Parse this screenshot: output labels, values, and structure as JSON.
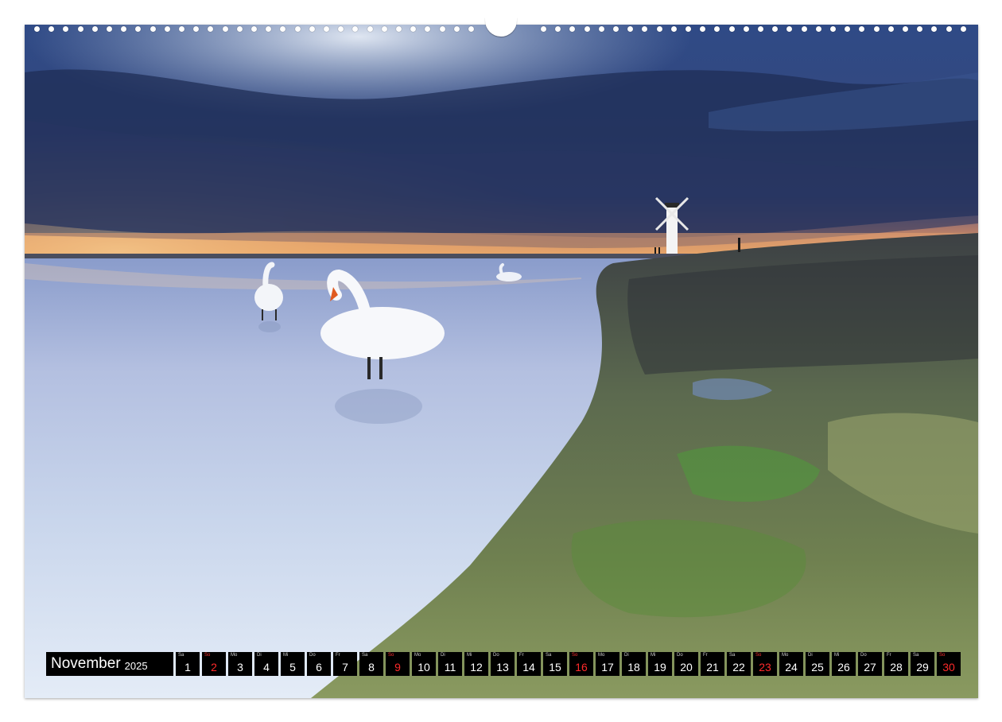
{
  "calendar": {
    "month": "November",
    "year": "2025",
    "days": [
      {
        "num": "1",
        "wd": "Sa",
        "sunday": false
      },
      {
        "num": "2",
        "wd": "So",
        "sunday": true
      },
      {
        "num": "3",
        "wd": "Mo",
        "sunday": false
      },
      {
        "num": "4",
        "wd": "Di",
        "sunday": false
      },
      {
        "num": "5",
        "wd": "Mi",
        "sunday": false
      },
      {
        "num": "6",
        "wd": "Do",
        "sunday": false
      },
      {
        "num": "7",
        "wd": "Fr",
        "sunday": false
      },
      {
        "num": "8",
        "wd": "Sa",
        "sunday": false
      },
      {
        "num": "9",
        "wd": "So",
        "sunday": true
      },
      {
        "num": "10",
        "wd": "Mo",
        "sunday": false
      },
      {
        "num": "11",
        "wd": "Di",
        "sunday": false
      },
      {
        "num": "12",
        "wd": "Mi",
        "sunday": false
      },
      {
        "num": "13",
        "wd": "Do",
        "sunday": false
      },
      {
        "num": "14",
        "wd": "Fr",
        "sunday": false
      },
      {
        "num": "15",
        "wd": "Sa",
        "sunday": false
      },
      {
        "num": "16",
        "wd": "So",
        "sunday": true
      },
      {
        "num": "17",
        "wd": "Mo",
        "sunday": false
      },
      {
        "num": "18",
        "wd": "Di",
        "sunday": false
      },
      {
        "num": "19",
        "wd": "Mi",
        "sunday": false
      },
      {
        "num": "20",
        "wd": "Do",
        "sunday": false
      },
      {
        "num": "21",
        "wd": "Fr",
        "sunday": false
      },
      {
        "num": "22",
        "wd": "Sa",
        "sunday": false
      },
      {
        "num": "23",
        "wd": "So",
        "sunday": true
      },
      {
        "num": "24",
        "wd": "Mo",
        "sunday": false
      },
      {
        "num": "25",
        "wd": "Di",
        "sunday": false
      },
      {
        "num": "26",
        "wd": "Mi",
        "sunday": false
      },
      {
        "num": "27",
        "wd": "Do",
        "sunday": false
      },
      {
        "num": "28",
        "wd": "Fr",
        "sunday": false
      },
      {
        "num": "29",
        "wd": "Sa",
        "sunday": false
      },
      {
        "num": "30",
        "wd": "So",
        "sunday": true
      }
    ]
  },
  "colors": {
    "sunday": "#ff2a2a",
    "bar": "#000000",
    "text": "#ffffff"
  }
}
